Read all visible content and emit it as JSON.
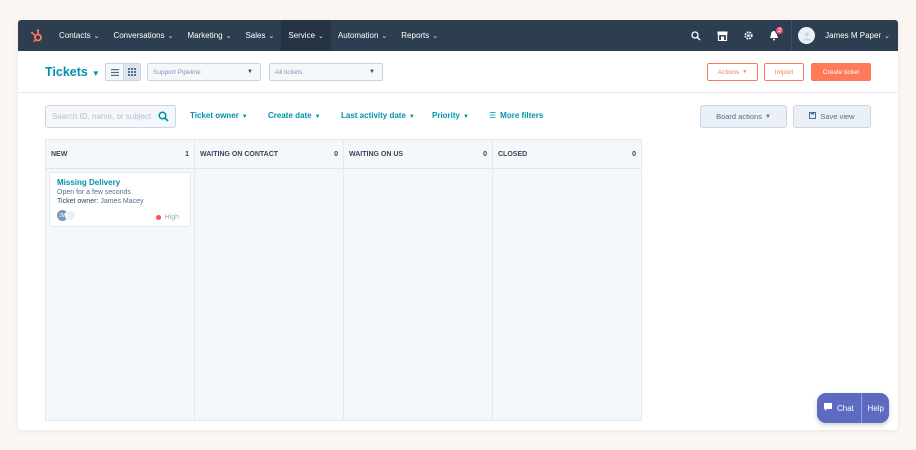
{
  "topnav": {
    "items": [
      {
        "label": "Contacts"
      },
      {
        "label": "Conversations"
      },
      {
        "label": "Marketing"
      },
      {
        "label": "Sales"
      },
      {
        "label": "Service"
      },
      {
        "label": "Automation"
      },
      {
        "label": "Reports"
      }
    ],
    "active_item": "Service",
    "notification_count": "2",
    "user_name": "James M Paper",
    "icons": [
      "search-icon",
      "marketplace-icon",
      "settings-icon",
      "notifications-icon"
    ]
  },
  "header": {
    "title": "Tickets",
    "pipeline_select": "Support Pipeline",
    "view_select": "All tickets",
    "actions_label": "Actions",
    "import_label": "Import",
    "create_label": "Create ticket"
  },
  "filters": {
    "search_placeholder": "Search ID, name, or subject",
    "items": [
      "Ticket owner",
      "Create date",
      "Last activity date",
      "Priority"
    ],
    "more_filters": "More filters",
    "board_actions": "Board actions",
    "save_view": "Save view"
  },
  "board": {
    "columns": [
      {
        "title": "NEW",
        "count": "1"
      },
      {
        "title": "WAITING ON CONTACT",
        "count": "0"
      },
      {
        "title": "WAITING ON US",
        "count": "0"
      },
      {
        "title": "CLOSED",
        "count": "0"
      }
    ],
    "card": {
      "title": "Missing Delivery",
      "open_time": "Open for a few seconds",
      "owner_label": "Ticket owner:",
      "owner_name": "James Macey",
      "avatar_initials": "JM",
      "priority": "High"
    }
  },
  "chat_widget": {
    "chat_label": "Chat",
    "help_label": "Help"
  },
  "colors": {
    "nav_bg": "#2d3e50",
    "accent_teal": "#0091ae",
    "accent_orange": "#ff7a59",
    "priority_high": "#f2545b",
    "chat_bg": "#5c6bc0"
  }
}
